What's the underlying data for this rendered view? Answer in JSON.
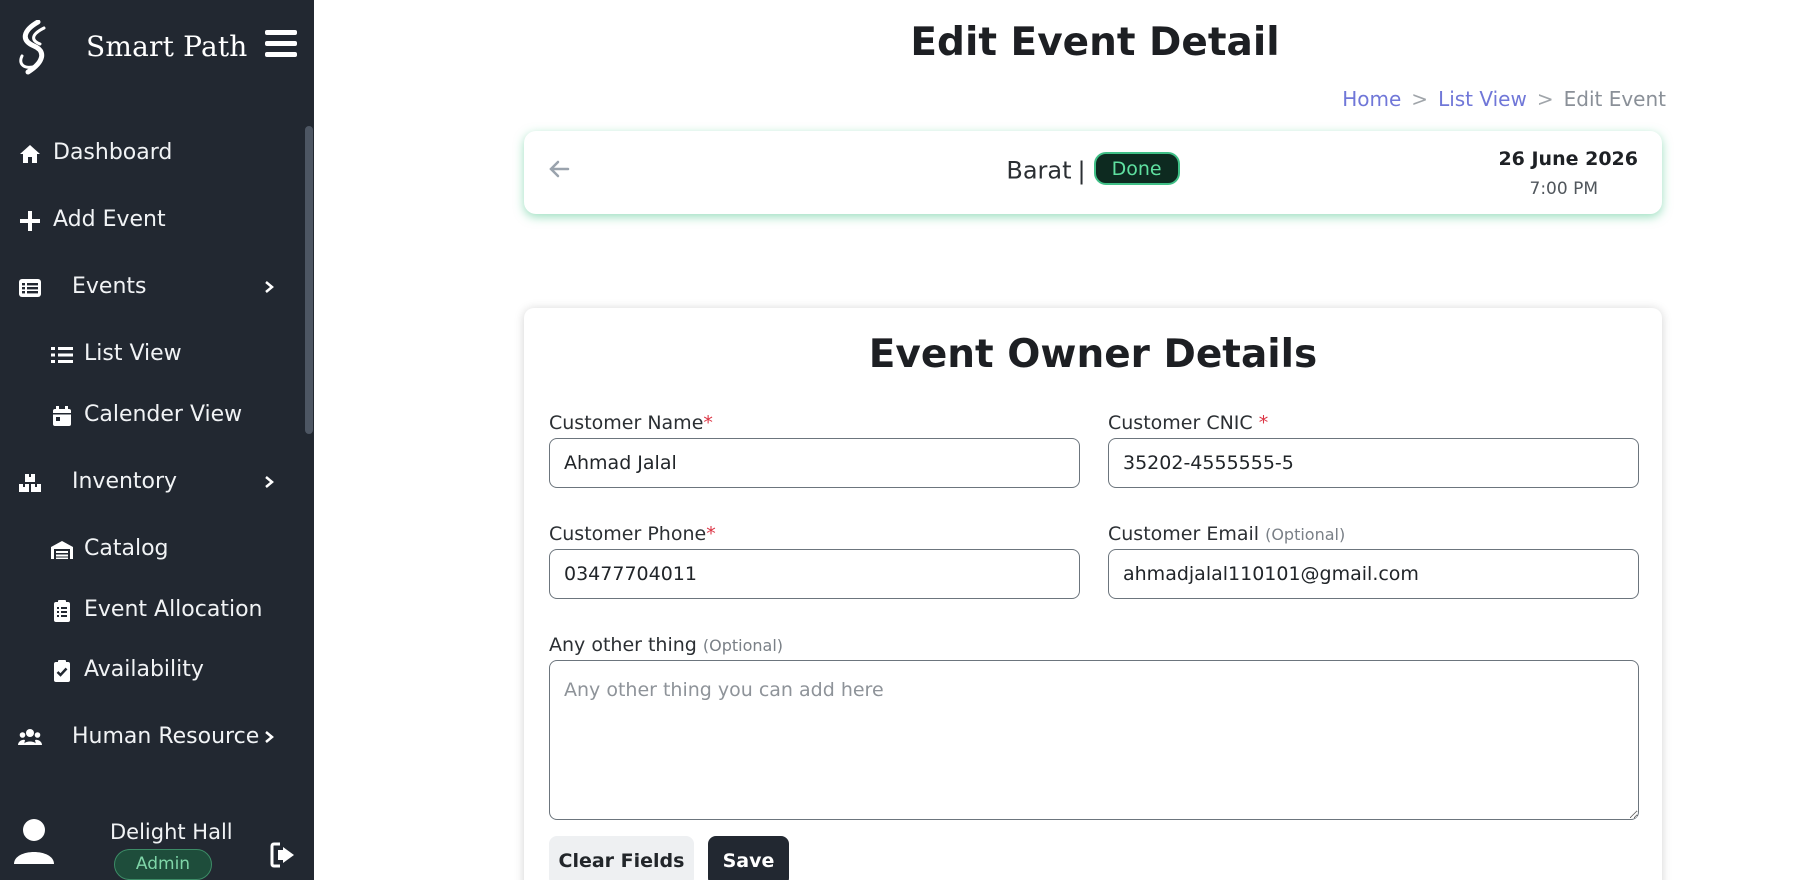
{
  "brand": {
    "name": "Smart Path"
  },
  "sidebar": {
    "items": [
      {
        "label": "Dashboard",
        "icon": "home-icon"
      },
      {
        "label": "Add Event",
        "icon": "plus-icon"
      },
      {
        "label": "Events",
        "icon": "list-box-icon",
        "expandable": true
      },
      {
        "label": "List View",
        "icon": "list-icon",
        "sub": true
      },
      {
        "label": "Calender View",
        "icon": "calendar-icon",
        "sub": true
      },
      {
        "label": "Inventory",
        "icon": "boxes-icon",
        "expandable": true
      },
      {
        "label": "Catalog",
        "icon": "warehouse-icon",
        "sub": true
      },
      {
        "label": "Event Allocation",
        "icon": "clipboard-list-icon",
        "sub": true
      },
      {
        "label": "Availability",
        "icon": "clipboard-check-icon",
        "sub": true
      },
      {
        "label": "Human Resource",
        "icon": "users-icon",
        "expandable": true
      }
    ],
    "user": {
      "name": "Delight Hall",
      "role": "Admin"
    }
  },
  "header": {
    "title": "Edit Event Detail",
    "breadcrumb": {
      "home": "Home",
      "list": "List View",
      "current": "Edit Event",
      "separator": ">"
    }
  },
  "event": {
    "name": "Barat",
    "separator": "|",
    "status": "Done",
    "date": "26 June 2026",
    "time": "7:00 PM"
  },
  "form": {
    "title": "Event Owner Details",
    "customer_name": {
      "label": "Customer Name",
      "required": "*",
      "value": "Ahmad Jalal"
    },
    "customer_cnic": {
      "label": "Customer CNIC ",
      "required": "*",
      "value": "35202-4555555-5"
    },
    "customer_phone": {
      "label": "Customer Phone",
      "required": "*",
      "value": "03477704011"
    },
    "customer_email": {
      "label": "Customer Email ",
      "optional": "(Optional)",
      "value": "ahmadjalal110101@gmail.com"
    },
    "other": {
      "label": "Any other thing ",
      "optional": "(Optional)",
      "placeholder": "Any other thing you can add here",
      "value": ""
    },
    "clear_label": "Clear Fields",
    "save_label": "Save"
  },
  "colors": {
    "sidebar_bg": "#222831",
    "accent_green": "#3fbf86",
    "link": "#7077d8",
    "required": "#dc3545"
  }
}
